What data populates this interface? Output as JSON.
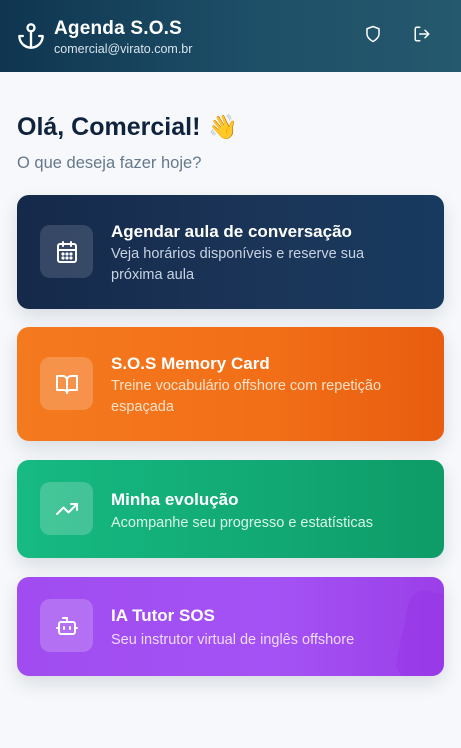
{
  "header": {
    "app_title": "Agenda S.O.S",
    "user_email": "comercial@virato.com.br",
    "icons": {
      "brand": "anchor-icon",
      "security": "shield-icon",
      "logout": "logout-icon"
    }
  },
  "main": {
    "greeting": "Olá, Comercial!",
    "greeting_emoji": "👋",
    "subtitle": "O que deseja fazer hoje?"
  },
  "cards": [
    {
      "title": "Agendar aula de conversação",
      "description": "Veja horários disponíveis e reserve sua próxima aula",
      "icon": "calendar-icon",
      "color": "#1b3558"
    },
    {
      "title": "S.O.S Memory Card",
      "description": "Treine vocabulário offshore com repetição espaçada",
      "icon": "book-open-icon",
      "color": "#f26e17"
    },
    {
      "title": "Minha evolução",
      "description": "Acompanhe seu progresso e estatísticas",
      "icon": "trending-up-icon",
      "color": "#12a874"
    },
    {
      "title": "IA Tutor SOS",
      "description": "Seu instrutor virtual de inglês offshore",
      "icon": "bot-icon",
      "color": "#a452f5"
    }
  ]
}
